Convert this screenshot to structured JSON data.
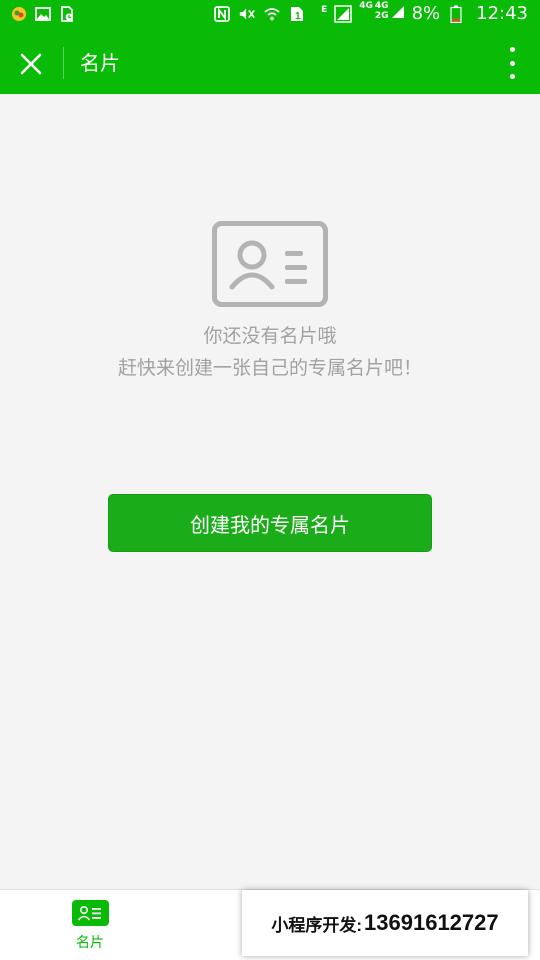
{
  "status_bar": {
    "network_label": "E",
    "lte_label_1": "4G",
    "lte_label_2": "4G",
    "lte_label_3": "2G",
    "battery_percent": "8%",
    "time": "12:43",
    "icons": [
      "app-notification-icon",
      "image-icon",
      "download-icon",
      "nfc-icon",
      "mute-icon",
      "wifi-icon",
      "sim-icon",
      "signal-icon",
      "battery-icon"
    ]
  },
  "nav": {
    "title": "名片",
    "close_icon": "close-icon",
    "more_icon": "more-vertical-icon"
  },
  "empty_state": {
    "icon": "business-card-icon",
    "line1": "你还没有名片哦",
    "line2": "赶快来创建一张自己的专属名片吧！"
  },
  "create_button": {
    "label": "创建我的专属名片"
  },
  "tab_bar": {
    "items": [
      {
        "label": "名片",
        "icon": "business-card-icon",
        "active": true
      }
    ]
  },
  "promo": {
    "label": "小程序开发:",
    "number": "13691612727"
  },
  "colors": {
    "brand_green": "#09bb07",
    "button_green": "#1aad19",
    "background": "#f4f4f4",
    "muted_text": "#a2a2a2"
  }
}
